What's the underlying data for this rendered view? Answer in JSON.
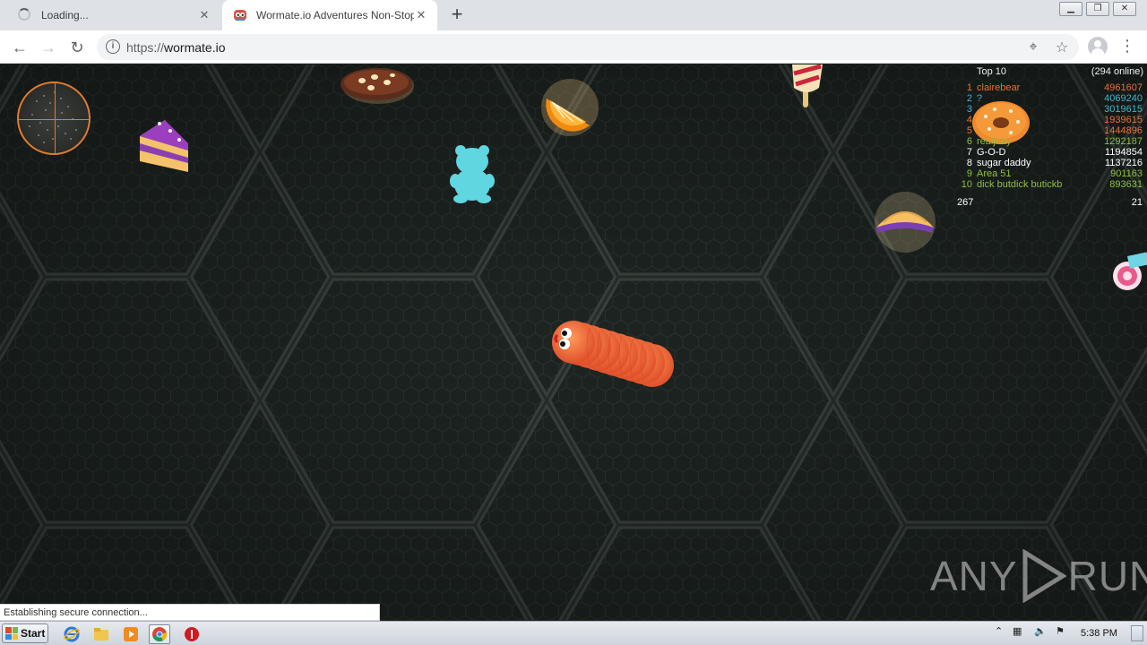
{
  "browser": {
    "tabs": [
      {
        "title": "Loading...",
        "state": "loading",
        "icon": "loading-spinner-icon"
      },
      {
        "title": "Wormate.io Adventures Non-Stop",
        "state": "active",
        "icon": "wormate-favicon-icon"
      }
    ],
    "new_tab_icon": "plus-icon",
    "window_buttons": [
      "minimize",
      "restore",
      "close"
    ],
    "url": {
      "protocol": "https://",
      "host": "wormate.io"
    },
    "toolbar_icons": [
      "back-icon",
      "forward-icon",
      "reload-icon",
      "info-icon",
      "location-icon",
      "star-icon",
      "profile-icon",
      "menu-icon"
    ],
    "status_text": "Establishing secure connection..."
  },
  "game": {
    "leaderboard": {
      "title": "Top 10",
      "online": "(294 online)",
      "rows": [
        {
          "rank": "1",
          "name": "clairebear",
          "score": "4961607",
          "color": "#e8703a"
        },
        {
          "rank": "2",
          "name": "?",
          "score": "4069240",
          "color": "#3fb6c7"
        },
        {
          "rank": "3",
          "name": "",
          "score": "3019615",
          "color": "#3fb6c7"
        },
        {
          "rank": "4",
          "name": "",
          "score": "1939615",
          "color": "#e8703a"
        },
        {
          "rank": "5",
          "name": "",
          "score": "1444896",
          "color": "#e8703a"
        },
        {
          "rank": "6",
          "name": "realjetty",
          "score": "1292187",
          "color": "#8fbf3f"
        },
        {
          "rank": "7",
          "name": "G-O-D",
          "score": "1194854",
          "color": "#ffffff"
        },
        {
          "rank": "8",
          "name": "sugar daddy",
          "score": "1137216",
          "color": "#ffffff"
        },
        {
          "rank": "9",
          "name": "Area 51",
          "score": "901163",
          "color": "#8fbf3f"
        },
        {
          "rank": "10",
          "name": "dick butdick butickb",
          "score": "893631",
          "color": "#8fbf3f"
        }
      ],
      "footer_left": "267",
      "footer_right": "21"
    },
    "watermark": "ANY RUN"
  },
  "taskbar": {
    "start_label": "Start",
    "clock": "5:38 PM",
    "apps": [
      "internet-explorer-icon",
      "folder-icon",
      "media-player-icon",
      "chrome-icon",
      "antivirus-icon"
    ]
  },
  "colors": {
    "worm": "#f26b3a",
    "minimap_ring": "#e07b2e",
    "game_bg": "#1d2421"
  }
}
